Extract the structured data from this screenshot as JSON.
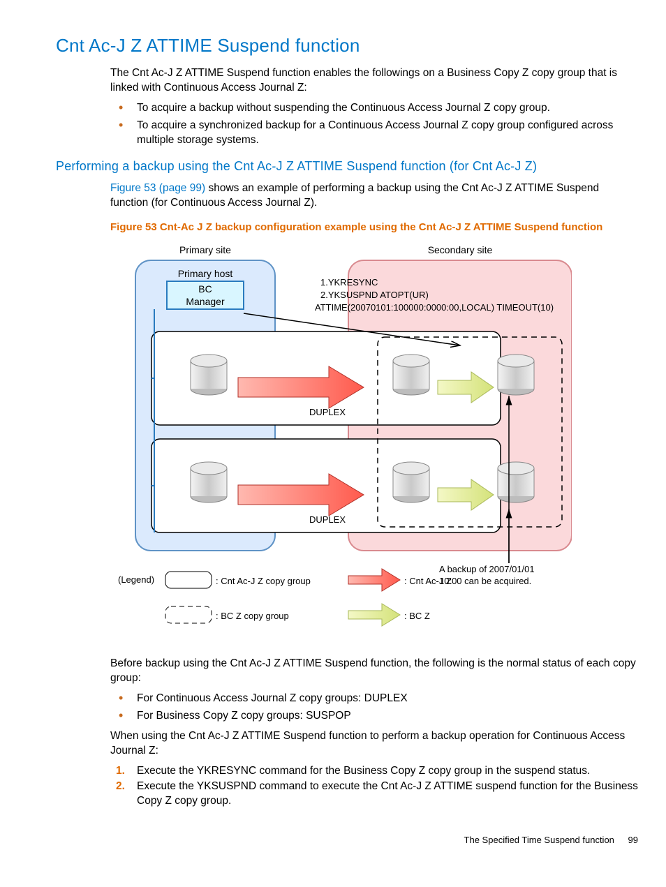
{
  "title": "Cnt Ac-J Z ATTIME Suspend function",
  "intro": "The Cnt Ac-J Z ATTIME Suspend function enables the followings on a Business Copy Z copy group that is linked with Continuous Access Journal Z:",
  "intro_bullets": [
    "To acquire a backup without suspending the Continuous Access Journal Z copy group.",
    "To acquire a synchronized backup for a Continuous Access Journal Z copy group configured across multiple storage systems."
  ],
  "subhead": "Performing a backup using the Cnt Ac-J Z ATTIME Suspend function (for Cnt Ac-J Z)",
  "figref": "Figure 53 (page 99)",
  "figref_tail": " shows an example of performing a backup using the Cnt Ac-J Z ATTIME Suspend function (for Continuous Access Journal Z).",
  "figcaption": "Figure 53 Cnt-Ac J Z backup configuration example using the Cnt Ac-J Z ATTIME Suspend function",
  "diagram": {
    "primary_site": "Primary site",
    "secondary_site": "Secondary site",
    "primary_host": "Primary host",
    "bc_manager": "BC Manager",
    "cmd1": "1.YKRESYNC",
    "cmd2": "2.YKSUSPND ATOPT(UR)",
    "cmd2b": "ATTIME(20070101:100000:0000:00,LOCAL) TIMEOUT(10)",
    "duplex": "DUPLEX",
    "backup_note1": "A backup of 2007/01/01",
    "backup_note2": "10:00 can be acquired.",
    "legend_title": "(Legend)",
    "l_cnt_group": ": Cnt Ac-J Z copy group",
    "l_bc_group": ": BC Z copy group",
    "l_cnt": ": Cnt Ac-J Z",
    "l_bc": ": BC Z"
  },
  "prebackup": "Before backup using the Cnt Ac-J Z ATTIME Suspend function, the following is the normal status of each copy group:",
  "prebackup_bullets": [
    "For Continuous Access Journal Z copy groups: DUPLEX",
    "For Business Copy Z copy groups: SUSPOP"
  ],
  "whenusing": "When using the Cnt Ac-J Z ATTIME Suspend function to perform a backup operation for Continuous Access Journal Z:",
  "steps": [
    "Execute the YKRESYNC command for the Business Copy Z copy group in the suspend status.",
    "Execute the YKSUSPND command to execute the Cnt Ac-J Z ATTIME suspend function for the Business Copy Z copy group."
  ],
  "footer_text": "The Specified Time Suspend function",
  "footer_page": "99"
}
